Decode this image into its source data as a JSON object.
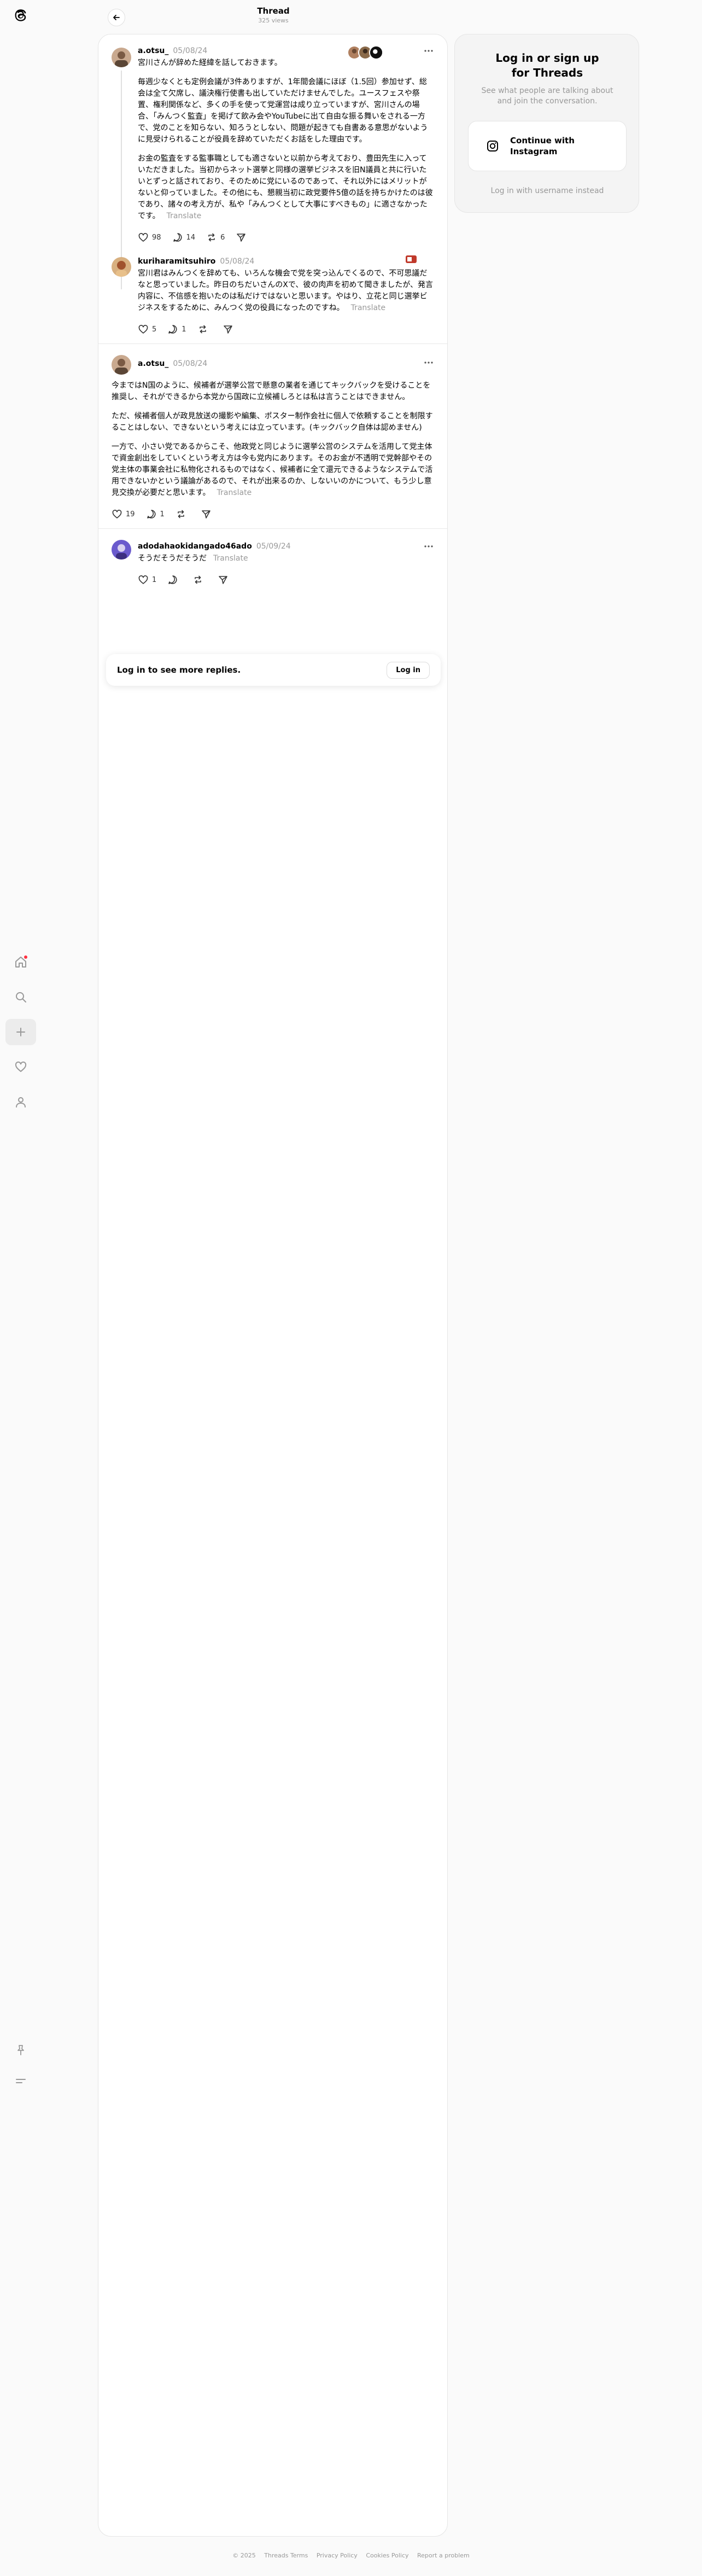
{
  "header": {
    "title": "Thread",
    "views": "325 views"
  },
  "posts": [
    {
      "username": "a.otsu_",
      "date": "05/08/24",
      "paragraphs": [
        "宮川さんが辞めた経緯を話しておきます。",
        "毎週少なくとも定例会議が3件ありますが、1年間会議にほぼ（1.5回）参加せず、総会は全て欠席し、議決権行使書も出していただけませんでした。ユースフェスや祭置、権利関係など、多くの手を使って党運営は成り立っていますが、宮川さんの場合、「みんつく監査」を掲げて飲み会やYouTubeに出て自由な振る舞いをされる一方で、党のことを知らない、知ろうとしない、問題が起きても自書ある意思がないように見受けられることが役員を辞めていただくお話をした理由です。",
        "お金の監査をする監事職としても適さないと以前から考えており、豊田先生に入っていただきました。当初からネット選挙と同様の選挙ビジネスを旧N議員と共に行いたいとずっと話されており、そのために党にいるのであって、それ以外にはメリットがないと仰っていました。その他にも、懇親当初に政党要件5億の話を持ちかけたのは彼であり、諸々の考え方が、私や「みんつくとして大事にすべきもの」に適さなかったです。"
      ],
      "translate": "Translate",
      "likes": "98",
      "replies": "14",
      "reposts": "6"
    },
    {
      "username": "kuriharamitsuhiro",
      "date": "05/08/24",
      "paragraphs": [
        "宮川君はみんつくを辞めても、いろんな機会で党を突っ込んでくるので、不可思議だなと思っていました。昨日のちだいさんのXで、彼の肉声を初めて聞きましたが、発言内容に、不信感を抱いたのは私だけではないと思います。やはり、立花と同じ選挙ビジネスをするために、みんつく党の役員になったのですね。"
      ],
      "translate": "Translate",
      "likes": "5",
      "replies": "1",
      "reposts": ""
    },
    {
      "username": "a.otsu_",
      "date": "05/08/24",
      "paragraphs": [
        "今まではN国のように、候補者が選挙公営で懸意の業者を通じてキックバックを受けることを推奨し、それができるから本党から国政に立候補しろとは私は言うことはできません。",
        "ただ、候補者個人が政見放送の撮影や編集、ポスター制作会社に個人で依頼することを制限することはしない、できないという考えには立っています。(キックバック自体は認めません)",
        "一方で、小さい党であるからこそ、他政党と同じように選挙公営のシステムを活用して党主体で資金創出をしていくという考え方は今も党内にあります。そのお金が不透明で党幹部やその党主体の事業会社に私物化されるものではなく、候補者に全て還元できるようなシステムで活用できないかという議論があるので、それが出来るのか、しないいのかについて、もう少し意見交換が必要だと思います。"
      ],
      "translate": "Translate",
      "likes": "19",
      "replies": "1",
      "reposts": ""
    },
    {
      "username": "adodahaokidangado46ado",
      "date": "05/09/24",
      "paragraphs": [
        "そうだそうだそうだ"
      ],
      "translate": "Translate",
      "likes": "1",
      "replies": "",
      "reposts": ""
    }
  ],
  "login_strip": {
    "text": "Log in to see more replies.",
    "button": "Log in"
  },
  "signup_card": {
    "title": "Log in or sign up\nfor Threads",
    "subtitle": "See what people are talking about and join the conversation.",
    "instagram_button": "Continue with\nInstagram",
    "alt_link": "Log in with username instead"
  },
  "footer": {
    "copyright": "© 2025",
    "terms": "Threads Terms",
    "privacy": "Privacy Policy",
    "cookies": "Cookies Policy",
    "report": "Report a problem"
  },
  "icons": {
    "logo": "threads-logo",
    "home": "home-icon",
    "search": "search-icon",
    "create": "plus-icon",
    "activity": "heart-icon",
    "profile": "person-icon",
    "pin": "pin-icon",
    "menu": "menu-icon"
  },
  "colors": {
    "notification_dot": "#ff3040",
    "muted_text": "#999999",
    "background": "#fafafa"
  }
}
